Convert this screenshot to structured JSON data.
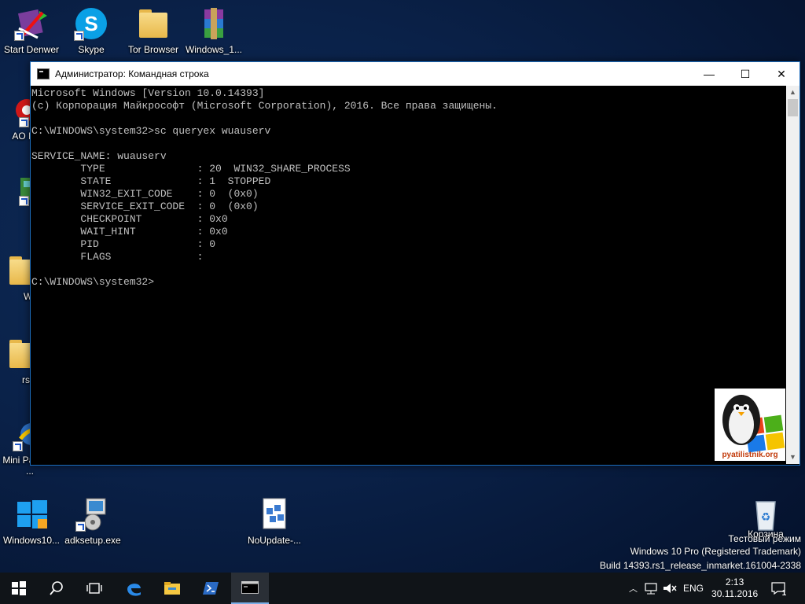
{
  "desktop": {
    "icons": [
      {
        "label": "Start Denwer"
      },
      {
        "label": "Skype"
      },
      {
        "label": "Tor Browser"
      },
      {
        "label": "Windows_1..."
      },
      {
        "label": "AO Partit"
      },
      {
        "label": "Ap"
      },
      {
        "label": "Windo"
      },
      {
        "label": "rsload."
      },
      {
        "label": "Mini Partition ..."
      },
      {
        "label": "Windows10..."
      },
      {
        "label": "adksetup.exe"
      },
      {
        "label": "NoUpdate-..."
      },
      {
        "label": "Корзина"
      }
    ]
  },
  "window": {
    "title": "Администратор: Командная строка",
    "minimize_glyph": "—",
    "maximize_glyph": "☐",
    "close_glyph": "✕",
    "console_lines": [
      "Microsoft Windows [Version 10.0.14393]",
      "(c) Корпорация Майкрософт (Microsoft Corporation), 2016. Все права защищены.",
      "",
      "C:\\WINDOWS\\system32>sc queryex wuauserv",
      "",
      "SERVICE_NAME: wuauserv",
      "        TYPE               : 20  WIN32_SHARE_PROCESS",
      "        STATE              : 1  STOPPED",
      "        WIN32_EXIT_CODE    : 0  (0x0)",
      "        SERVICE_EXIT_CODE  : 0  (0x0)",
      "        CHECKPOINT         : 0x0",
      "        WAIT_HINT          : 0x0",
      "        PID                : 0",
      "        FLAGS              :",
      "",
      "C:\\WINDOWS\\system32>"
    ]
  },
  "logo": {
    "text": "pyatilistnik.org"
  },
  "watermark": {
    "line1": "Тестовый режим",
    "line2": "Windows 10 Pro (Registered Trademark)",
    "line3": "Build 14393.rs1_release_inmarket.161004-2338"
  },
  "taskbar": {
    "tray": {
      "language": "ENG",
      "time": "2:13",
      "date": "30.11.2016",
      "notification_count": "1"
    }
  },
  "colors": {
    "console_bg": "#000000",
    "console_fg": "#c0c0c0",
    "accent": "#1c6dbd",
    "taskbar": "#101418"
  }
}
